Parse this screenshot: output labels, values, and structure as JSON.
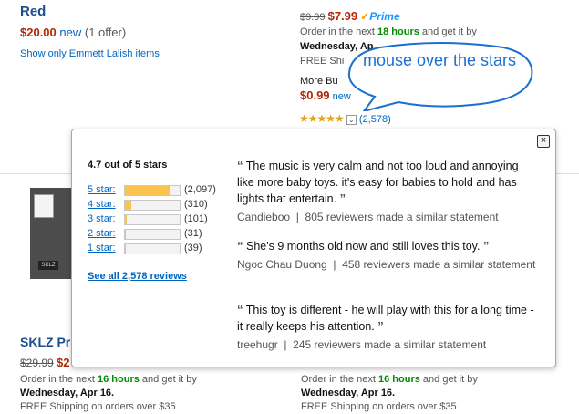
{
  "top_left": {
    "title": "Red",
    "price": "$20.00",
    "condition": "new",
    "offers": "(1 offer)",
    "show_only": "Show only Emmett Lalish items"
  },
  "top_right": {
    "list_price": "$9.99",
    "price": "$7.99",
    "prime": "Prime",
    "order_prefix": "Order in the next",
    "order_hours": "18 hours",
    "order_suffix": "and get it by",
    "delivery_date": "Wednesday, Ap",
    "free_shipping": "FREE Shi",
    "more_buying": "More Bu",
    "more_price": "$0.99",
    "more_new": "new",
    "review_count": "(2,578)"
  },
  "callout": {
    "text": "mouse over the stars"
  },
  "popover": {
    "summary": "4.7 out of 5 stars",
    "histogram": [
      {
        "label": "5 star",
        "count": "(2,097)",
        "fraction": 0.81
      },
      {
        "label": "4 star",
        "count": "(310)",
        "fraction": 0.12
      },
      {
        "label": "3 star",
        "count": "(101)",
        "fraction": 0.04
      },
      {
        "label": "2 star",
        "count": "(31)",
        "fraction": 0.012
      },
      {
        "label": "1 star",
        "count": "(39)",
        "fraction": 0.015
      }
    ],
    "see_all": "See all 2,578 reviews",
    "quotes": [
      {
        "text": "The music is very calm and not too loud and annoying like more baby toys. it's easy for babies to hold and has lights that entertain.",
        "author": "Candieboo",
        "similar": "805 reviewers made a similar statement"
      },
      {
        "text": "She's 9 months old now and still loves this toy.",
        "author": "Ngoc Chau Duong",
        "similar": "458 reviewers made a similar statement"
      },
      {
        "text": "This toy is different - he will play with this for a long time - it really keeps his attention.",
        "author": "treehugr",
        "similar": "245 reviewers made a similar statement"
      }
    ]
  },
  "bottom_left": {
    "logo": "SKLZ",
    "title": "SKLZ Pr",
    "list_price": "$29.99",
    "price": "$2",
    "order_prefix": "Order in the next",
    "order_hours": "16 hours",
    "order_suffix": "and get it by",
    "delivery_date": "Wednesday, Apr 16.",
    "free_shipping": "FREE Shipping on orders over $35"
  },
  "bottom_right": {
    "order_prefix": "Order in the next",
    "order_hours": "16 hours",
    "order_suffix": "and get it by",
    "delivery_date": "Wednesday, Apr 16.",
    "free_shipping": "FREE Shipping on orders over $35"
  },
  "colors": {
    "accent": "#0066c0",
    "price_red": "#b12704",
    "star": "#e7a117",
    "callout": "#1a6fd0"
  },
  "icons": {
    "close": "close-icon",
    "stars": "star-rating-icon",
    "chevron": "chevron-down-icon",
    "prime": "prime-icon"
  }
}
